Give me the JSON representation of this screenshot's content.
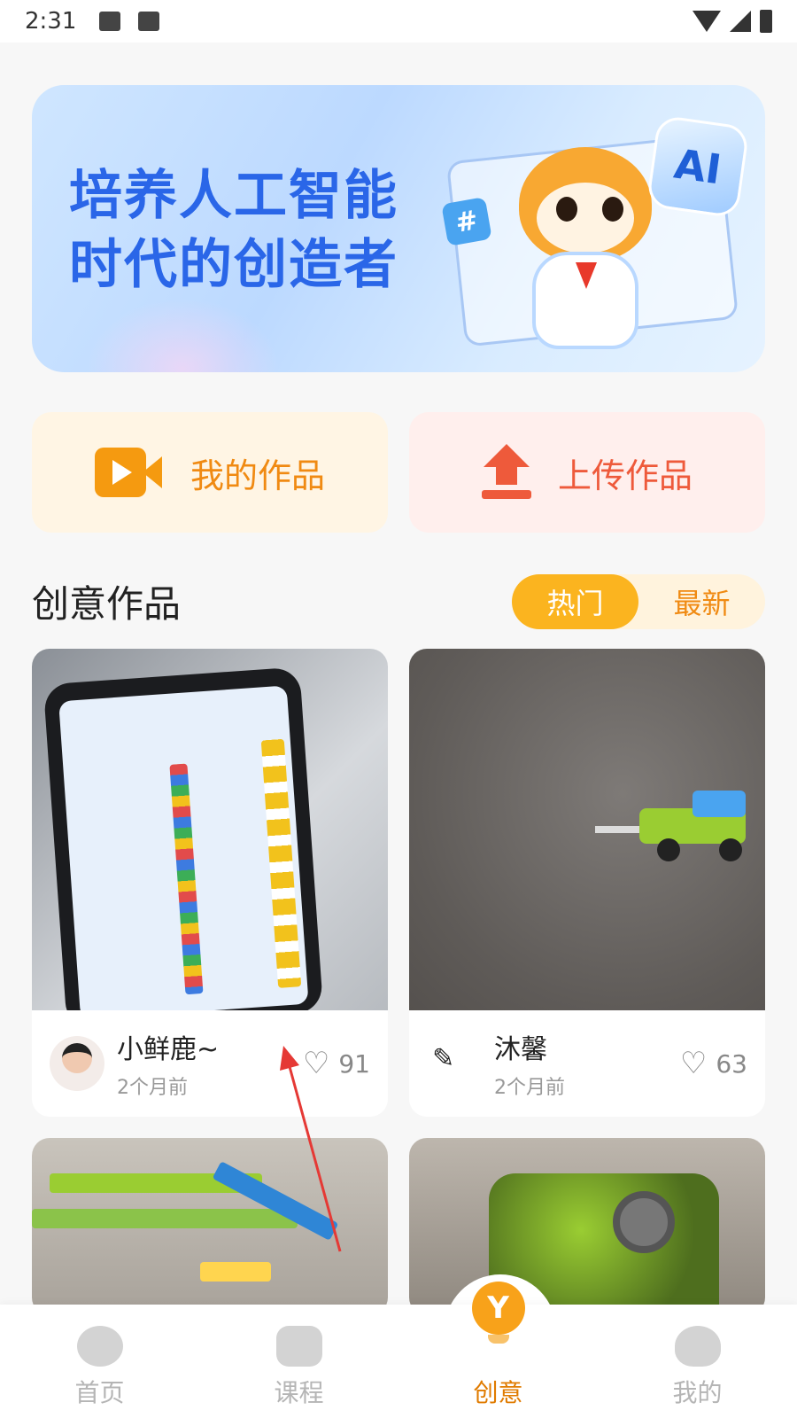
{
  "status_bar": {
    "time": "2:31"
  },
  "banner": {
    "title_line1": "培养人工智能",
    "title_line2": "时代的创造者",
    "hash_badge": "#",
    "ai_badge": "AI"
  },
  "actions": {
    "my_works": {
      "label": "我的作品",
      "icon": "video-camera-icon"
    },
    "upload": {
      "label": "上传作品",
      "icon": "upload-icon"
    }
  },
  "section": {
    "title": "创意作品",
    "sort_tabs": [
      {
        "label": "热门",
        "active": true
      },
      {
        "label": "最新",
        "active": false
      }
    ]
  },
  "works": [
    {
      "author": "小鲜鹿~",
      "time": "2个月前",
      "likes": "91"
    },
    {
      "author": "沐馨",
      "time": "2个月前",
      "likes": "63"
    }
  ],
  "tabbar": {
    "items": [
      {
        "label": "首页",
        "icon": "home-icon",
        "active": false
      },
      {
        "label": "课程",
        "icon": "course-icon",
        "active": false
      },
      {
        "label": "创意",
        "icon": "create-icon",
        "active": true
      },
      {
        "label": "我的",
        "icon": "profile-icon",
        "active": false
      }
    ]
  },
  "colors": {
    "accent": "#fbb41f",
    "orange_text": "#f08a12",
    "upload_red": "#ee5a3b",
    "banner_blue": "#2a66e8",
    "annotation_arrow": "#e53935"
  }
}
